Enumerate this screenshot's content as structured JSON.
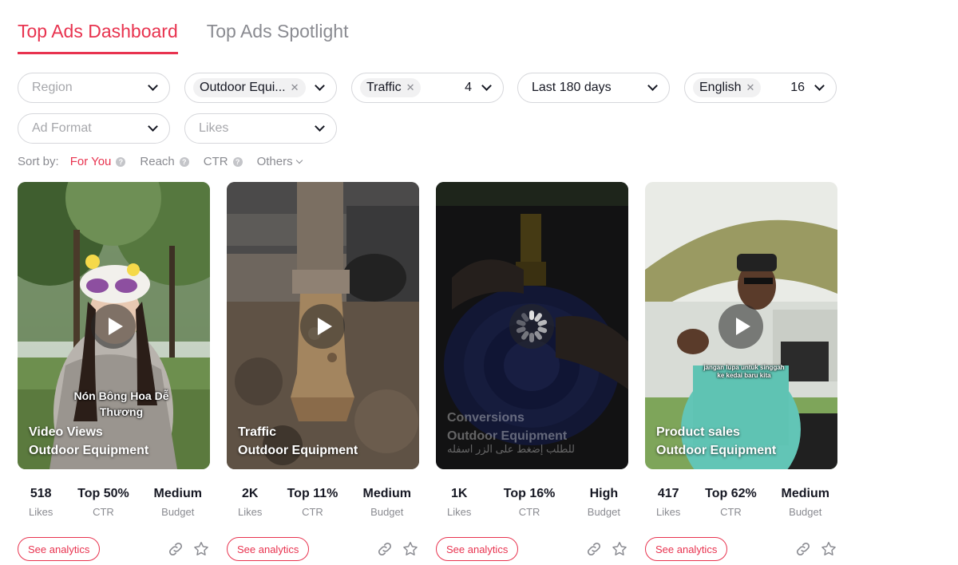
{
  "tabs": [
    {
      "label": "Top Ads Dashboard",
      "active": true
    },
    {
      "label": "Top Ads Spotlight",
      "active": false
    }
  ],
  "filters": {
    "region": {
      "placeholder": "Region"
    },
    "industry": {
      "chip": "Outdoor Equi...",
      "icon": "chevron-down-icon"
    },
    "objective": {
      "chip": "Traffic",
      "count": "4"
    },
    "period": {
      "value": "Last 180 days"
    },
    "language": {
      "chip": "English",
      "count": "16"
    },
    "ad_format": {
      "placeholder": "Ad Format"
    },
    "likes": {
      "placeholder": "Likes"
    }
  },
  "sort": {
    "label": "Sort by:",
    "options": [
      {
        "label": "For You",
        "active": true
      },
      {
        "label": "Reach"
      },
      {
        "label": "CTR"
      },
      {
        "label": "Others"
      }
    ]
  },
  "colors": {
    "accent": "#e8334f",
    "muted": "#8a8b91"
  },
  "cards": [
    {
      "objective": "Video Views",
      "industry": "Outdoor Equipment",
      "caption": "Nón Bông Hoa Dễ Thương",
      "likes": "518",
      "likes_label": "Likes",
      "ctr": "Top 50%",
      "ctr_label": "CTR",
      "budget": "Medium",
      "budget_label": "Budget",
      "cta": "See analytics"
    },
    {
      "objective": "Traffic",
      "industry": "Outdoor Equipment",
      "likes": "2K",
      "likes_label": "Likes",
      "ctr": "Top 11%",
      "ctr_label": "CTR",
      "budget": "Medium",
      "budget_label": "Budget",
      "cta": "See analytics"
    },
    {
      "objective": "Conversions",
      "industry": "Outdoor Equipment",
      "caption": "للطلب إضغط على الزر اسفله",
      "likes": "1K",
      "likes_label": "Likes",
      "ctr": "Top 16%",
      "ctr_label": "CTR",
      "budget": "High",
      "budget_label": "Budget",
      "cta": "See analytics"
    },
    {
      "objective": "Product sales",
      "industry": "Outdoor Equipment",
      "caption_line1": "jangan lupa untuk singgah",
      "caption_line2": "ke kedai baru kita",
      "likes": "417",
      "likes_label": "Likes",
      "ctr": "Top 62%",
      "ctr_label": "CTR",
      "budget": "Medium",
      "budget_label": "Budget",
      "cta": "See analytics"
    }
  ]
}
